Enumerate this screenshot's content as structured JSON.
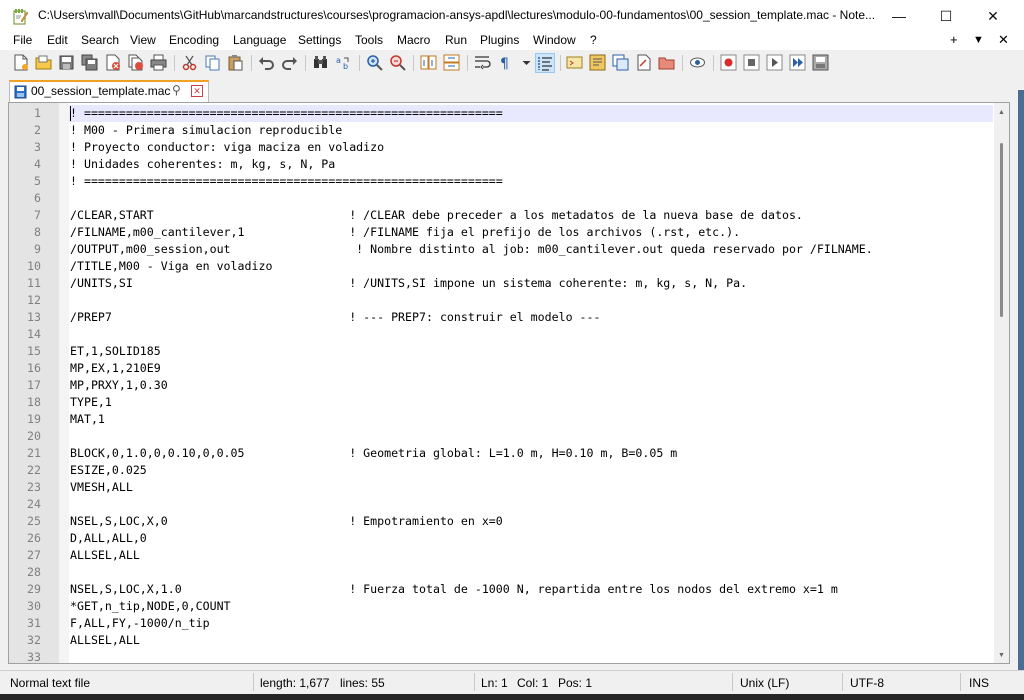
{
  "window": {
    "title": "C:\\Users\\mvall\\Documents\\GitHub\\marcandstructures\\courses\\programacion-ansys-apdl\\lectures\\modulo-00-fundamentos\\00_session_template.mac - Note...",
    "minimize_glyph": "—",
    "maximize_glyph": "☐",
    "close_glyph": "✕"
  },
  "menu": {
    "items": [
      "File",
      "Edit",
      "Search",
      "View",
      "Encoding",
      "Language",
      "Settings",
      "Tools",
      "Macro",
      "Run",
      "Plugins",
      "Window",
      "?"
    ],
    "right": {
      "add": "+",
      "dropdown": "▼",
      "close": "✕"
    }
  },
  "toolbar": {
    "icons": [
      "new-file-icon",
      "open-file-icon",
      "save-icon",
      "save-all-icon",
      "close-icon",
      "close-all-icon",
      "print-icon",
      "cut-icon",
      "copy-icon",
      "paste-icon",
      "undo-icon",
      "redo-icon",
      "find-icon",
      "replace-icon",
      "zoom-in-icon",
      "zoom-out-icon",
      "sync-vertical-icon",
      "sync-horizontal-icon",
      "word-wrap-icon",
      "show-all-chars-icon",
      "indent-guide-icon",
      "user-language-icon",
      "doc-map-icon",
      "function-list-icon",
      "folder-workspace-icon",
      "monitor-icon",
      "record-macro-icon",
      "stop-recording-icon",
      "play-macro-icon",
      "run-macro-multiple-icon",
      "save-macro-icon"
    ]
  },
  "tab": {
    "label": "00_session_template.mac",
    "pin": "📌",
    "close": "✕"
  },
  "editor": {
    "lines": [
      "! ============================================================",
      "! M00 - Primera simulacion reproducible",
      "! Proyecto conductor: viga maciza en voladizo",
      "! Unidades coherentes: m, kg, s, N, Pa",
      "! ============================================================",
      "",
      "/CLEAR,START                            ! /CLEAR debe preceder a los metadatos de la nueva base de datos.",
      "/FILNAME,m00_cantilever,1               ! /FILNAME fija el prefijo de los archivos (.rst, etc.).",
      "/OUTPUT,m00_session,out                  ! Nombre distinto al job: m00_cantilever.out queda reservado por /FILNAME.",
      "/TITLE,M00 - Viga en voladizo",
      "/UNITS,SI                               ! /UNITS,SI impone un sistema coherente: m, kg, s, N, Pa.",
      "",
      "/PREP7                                  ! --- PREP7: construir el modelo ---",
      "",
      "ET,1,SOLID185",
      "MP,EX,1,210E9",
      "MP,PRXY,1,0.30",
      "TYPE,1",
      "MAT,1",
      "",
      "BLOCK,0,1.0,0,0.10,0,0.05               ! Geometria global: L=1.0 m, H=0.10 m, B=0.05 m",
      "ESIZE,0.025",
      "VMESH,ALL",
      "",
      "NSEL,S,LOC,X,0                          ! Empotramiento en x=0",
      "D,ALL,ALL,0",
      "ALLSEL,ALL",
      "",
      "NSEL,S,LOC,X,1.0                        ! Fuerza total de -1000 N, repartida entre los nodos del extremo x=1 m",
      "*GET,n_tip,NODE,0,COUNT",
      "F,ALL,FY,-1000/n_tip",
      "ALLSEL,ALL",
      ""
    ],
    "line_numbers": [
      "1",
      "2",
      "3",
      "4",
      "5",
      "6",
      "7",
      "8",
      "9",
      "10",
      "11",
      "12",
      "13",
      "14",
      "15",
      "16",
      "17",
      "18",
      "19",
      "20",
      "21",
      "22",
      "23",
      "24",
      "25",
      "26",
      "27",
      "28",
      "29",
      "30",
      "31",
      "32",
      "33"
    ]
  },
  "status": {
    "file_type": "Normal text file",
    "length": "length: 1,677",
    "lines": "lines: 55",
    "ln": "Ln: 1",
    "col": "Col: 1",
    "pos": "Pos: 1",
    "eol": "Unix (LF)",
    "encoding": "UTF-8",
    "mode": "INS"
  },
  "colors": {
    "current_line": "#e8e8ff",
    "tab_accent": "#f0a023",
    "gutter": "#e4e4e4"
  }
}
